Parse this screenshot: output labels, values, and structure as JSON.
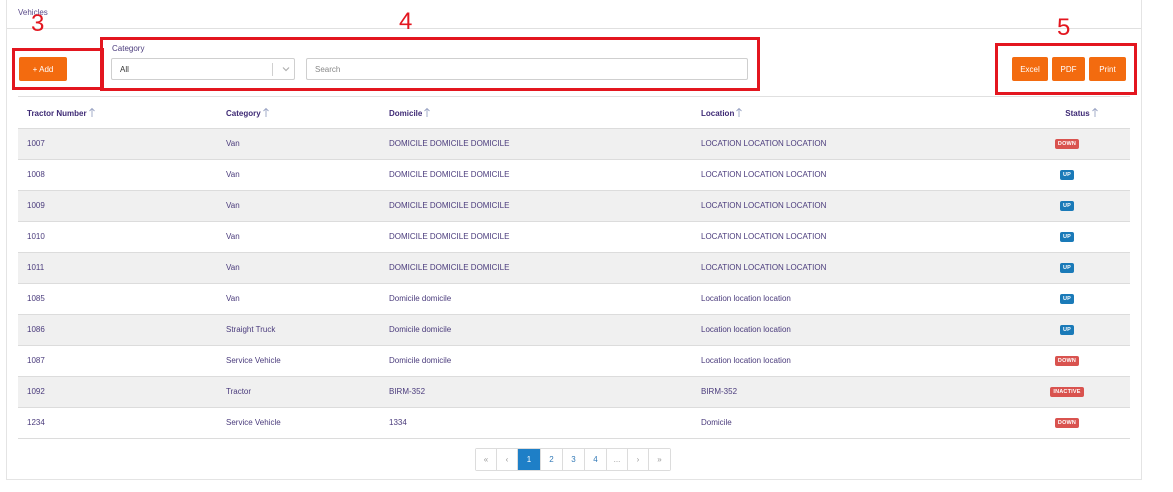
{
  "page": {
    "title": "Vehicles"
  },
  "annotations": [
    "3",
    "4",
    "5"
  ],
  "toolbar": {
    "add_label": "+ Add",
    "category_label": "Category",
    "category_value": "All",
    "search_placeholder": "Search",
    "excel_label": "Excel",
    "pdf_label": "PDF",
    "print_label": "Print"
  },
  "table": {
    "headers": [
      "Tractor Number",
      "Category",
      "Domicile",
      "Location",
      "Status"
    ],
    "rows": [
      [
        "1007",
        "Van",
        "DOMICILE DOMICILE DOMICILE",
        "LOCATION LOCATION LOCATION",
        "DOWN"
      ],
      [
        "1008",
        "Van",
        "DOMICILE DOMICILE DOMICILE",
        "LOCATION LOCATION LOCATION",
        "UP"
      ],
      [
        "1009",
        "Van",
        "DOMICILE DOMICILE DOMICILE",
        "LOCATION LOCATION LOCATION",
        "UP"
      ],
      [
        "1010",
        "Van",
        "DOMICILE DOMICILE DOMICILE",
        "LOCATION LOCATION LOCATION",
        "UP"
      ],
      [
        "1011",
        "Van",
        "DOMICILE DOMICILE DOMICILE",
        "LOCATION LOCATION LOCATION",
        "UP"
      ],
      [
        "1085",
        "Van",
        "Domicile domicile",
        "Location location location",
        "UP"
      ],
      [
        "1086",
        "Straight Truck",
        "Domicile domicile",
        "Location location location",
        "UP"
      ],
      [
        "1087",
        "Service Vehicle",
        "Domicile domicile",
        "Location location location",
        "DOWN"
      ],
      [
        "1092",
        "Tractor",
        "BIRM-352",
        "BIRM-352",
        "INACTIVE"
      ],
      [
        "1234",
        "Service Vehicle",
        "1334",
        "Domicile",
        "DOWN"
      ]
    ]
  },
  "status_colors": {
    "DOWN": "#d9534f",
    "UP": "#1a7ab8",
    "INACTIVE": "#d9534f"
  },
  "pagination": {
    "items": [
      "«",
      "‹",
      "1",
      "2",
      "3",
      "4",
      "...",
      "›",
      "»"
    ],
    "active": "1"
  },
  "colors": {
    "accent": "#f36b0f",
    "annotation": "#e3161f",
    "header_text": "#3e2a75",
    "page_active": "#1e7fc7"
  }
}
